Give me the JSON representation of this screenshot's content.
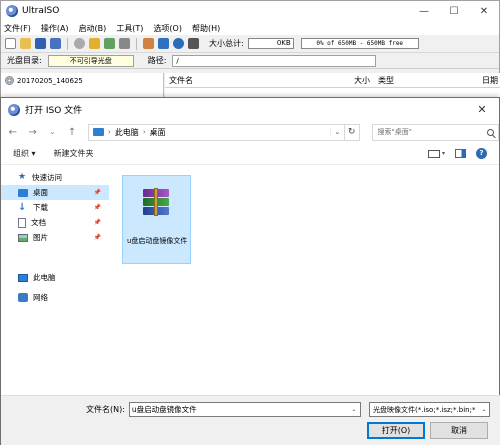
{
  "app": {
    "title": "UltraISO",
    "menu": [
      "文件(F)",
      "操作(A)",
      "启动(B)",
      "工具(T)",
      "选项(O)",
      "帮助(H)"
    ],
    "total_label": "大小总计:",
    "total_value": "0KB",
    "capacity_text": "0% of 650MB - 650MB free",
    "cd_label": "光盘目录:",
    "cd_value": "不可引导光盘",
    "path_label": "路径:",
    "path_value": "/",
    "tree_node": "20170205_140625",
    "columns": {
      "name": "文件名",
      "size": "大小",
      "type": "类型",
      "date": "日期"
    }
  },
  "dialog": {
    "title": "打开 ISO 文件",
    "breadcrumb": [
      "此电脑",
      "桌面"
    ],
    "search_placeholder": "搜索\"桌面\"",
    "organize": "组织 ▾",
    "new_folder": "新建文件夹",
    "help": "?",
    "nav": {
      "quick_access": "快速访问",
      "items": [
        "桌面",
        "下载",
        "文档",
        "图片"
      ],
      "this_pc": "此电脑",
      "network": "网络"
    },
    "file": {
      "name": "u盘启动盘镜像文件",
      "icon": "winrar-archive-icon"
    },
    "filename_label": "文件名(N):",
    "filename_value": "u盘启动盘镜像文件",
    "filetype_value": "光盘映像文件(*.iso;*.isz;*.bin;*",
    "open_button": "打开(O)",
    "cancel_button": "取消"
  }
}
